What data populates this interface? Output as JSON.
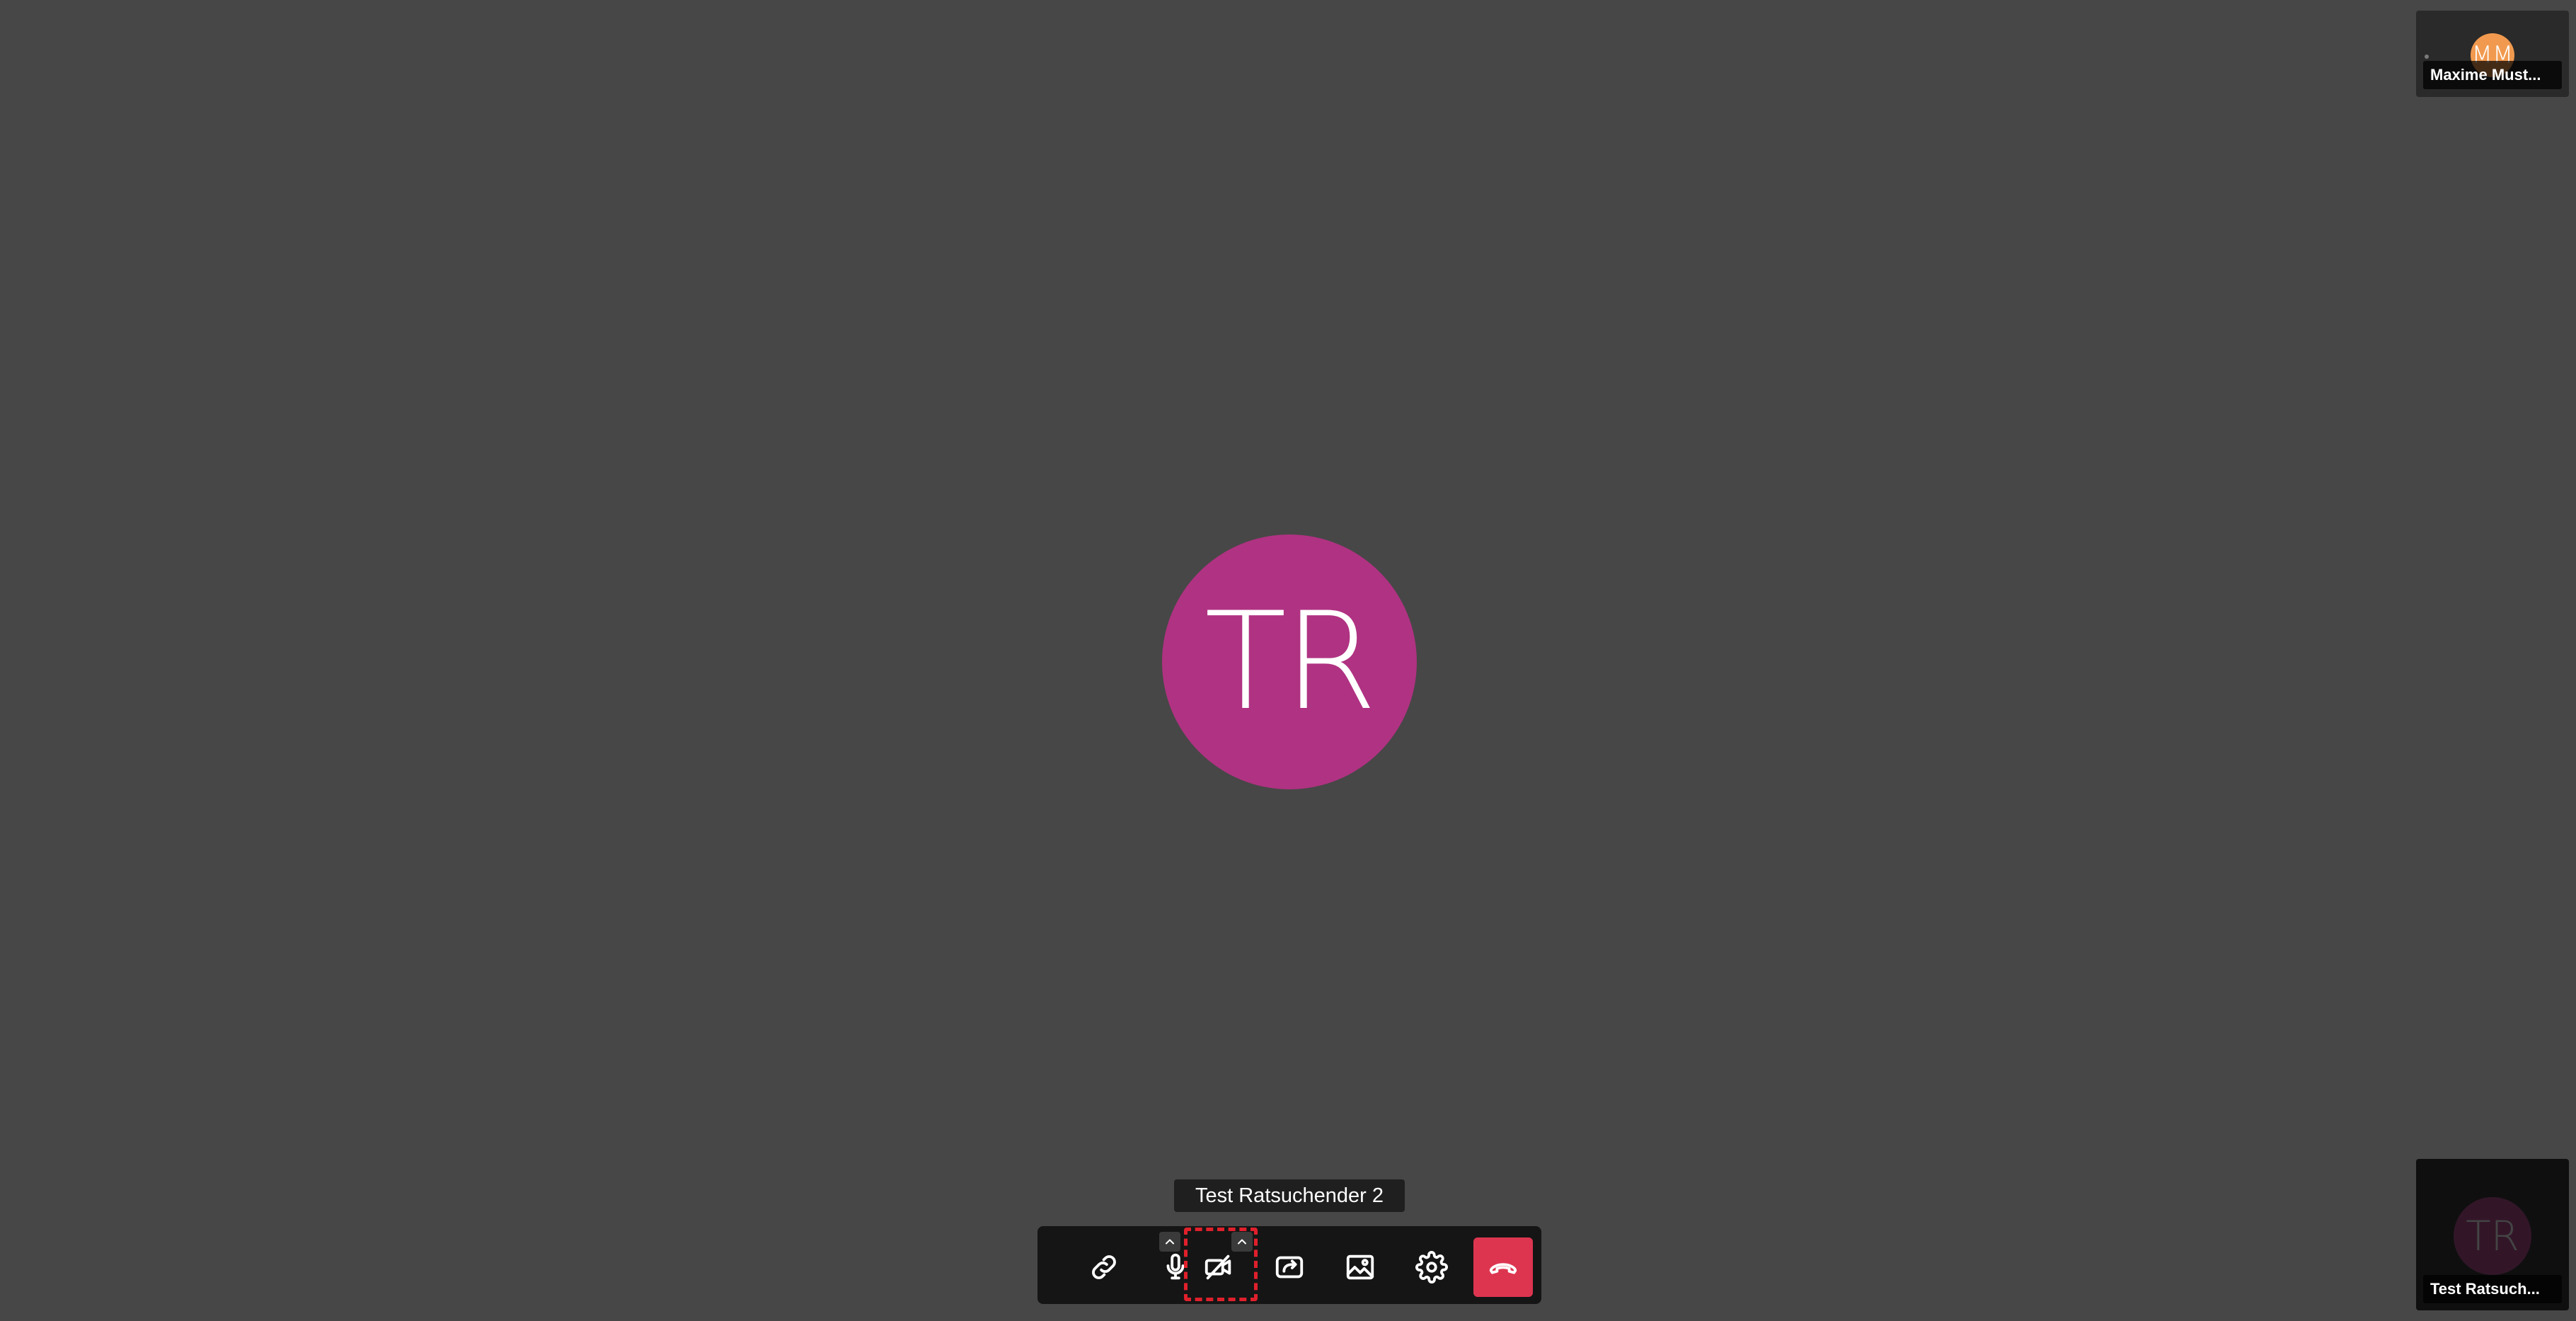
{
  "main": {
    "avatar_initials": "TR",
    "avatar_color": "#b03282"
  },
  "thumbnails": [
    {
      "initials": "MM",
      "name": "Maxime Must...",
      "avatar_color": "#f19a4f"
    },
    {
      "initials": "TR",
      "name": "Test Ratsuch...",
      "avatar_color": "#b03282"
    }
  ],
  "tooltip": {
    "text": "Test Ratsuchender 2"
  },
  "toolbar": {
    "buttons": [
      {
        "icon": "link-icon"
      },
      {
        "icon": "microphone-icon"
      },
      {
        "icon": "camera-off-icon",
        "highlighted": true
      },
      {
        "icon": "share-screen-icon"
      },
      {
        "icon": "background-image-icon"
      },
      {
        "icon": "gear-icon"
      },
      {
        "icon": "hangup-icon"
      }
    ],
    "hangup_color": "#dd3550",
    "highlight_color": "#e0202c"
  }
}
